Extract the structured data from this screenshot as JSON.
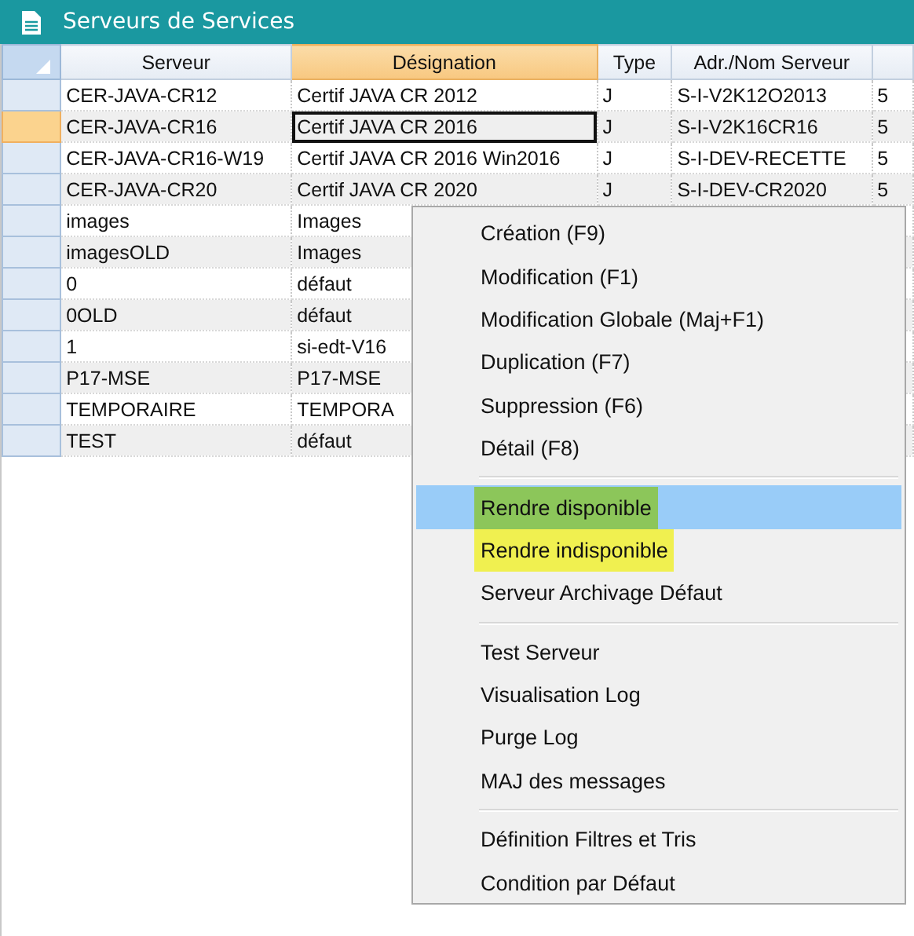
{
  "window": {
    "title": "Serveurs de Services"
  },
  "table": {
    "columns": [
      {
        "label": "Serveur",
        "selected": false
      },
      {
        "label": "Désignation",
        "selected": true
      },
      {
        "label": "Type",
        "selected": false
      },
      {
        "label": "Adr./Nom Serveur",
        "selected": false
      },
      {
        "selected": false
      }
    ],
    "rows": [
      {
        "selected": false,
        "cells": [
          "CER-JAVA-CR12",
          "Certif JAVA CR 2012",
          "J",
          "S-I-V2K12O2013",
          "5"
        ]
      },
      {
        "selected": true,
        "cells": [
          "CER-JAVA-CR16",
          "Certif JAVA CR 2016",
          "J",
          "S-I-V2K16CR16",
          "5"
        ]
      },
      {
        "selected": false,
        "cells": [
          "CER-JAVA-CR16-W19",
          "Certif JAVA CR 2016 Win2016",
          "J",
          "S-I-DEV-RECETTE",
          "5"
        ]
      },
      {
        "selected": false,
        "cells": [
          "CER-JAVA-CR20",
          "Certif JAVA CR 2020",
          "J",
          "S-I-DEV-CR2020",
          "5"
        ]
      },
      {
        "selected": false,
        "cells": [
          "images",
          "Images"
        ]
      },
      {
        "selected": false,
        "cells": [
          "imagesOLD",
          "Images"
        ]
      },
      {
        "selected": false,
        "cells": [
          "0",
          "défaut"
        ]
      },
      {
        "selected": false,
        "cells": [
          "0OLD",
          "défaut"
        ]
      },
      {
        "selected": false,
        "cells": [
          "1",
          "si-edt-V16"
        ]
      },
      {
        "selected": false,
        "cells": [
          "P17-MSE",
          "P17-MSE"
        ]
      },
      {
        "selected": false,
        "cells": [
          "TEMPORAIRE",
          "TEMPORA"
        ]
      },
      {
        "selected": false,
        "cells": [
          "TEST",
          "défaut"
        ]
      }
    ]
  },
  "context_menu": {
    "groups": [
      [
        {
          "label": "Création (F9)",
          "selected": false
        },
        {
          "label": "Modification (F1)",
          "selected": false
        },
        {
          "label": "Modification Globale (Maj+F1)",
          "selected": false
        },
        {
          "label": "Duplication (F7)",
          "selected": false
        },
        {
          "label": "Suppression (F6)",
          "selected": false
        },
        {
          "label": "Détail (F8)",
          "selected": false
        }
      ],
      [
        {
          "label": "Rendre disponible",
          "selected": true,
          "color": "#8cc65a"
        },
        {
          "label": "Rendre indisponible",
          "selected": false,
          "color": "#f0f050"
        },
        {
          "label": "Serveur Archivage Défaut",
          "selected": false
        }
      ],
      [
        {
          "label": "Test Serveur",
          "selected": false
        },
        {
          "label": "Visualisation Log",
          "selected": false
        },
        {
          "label": "Purge Log",
          "selected": false
        },
        {
          "label": "MAJ des messages",
          "selected": false
        }
      ],
      [
        {
          "label": "Définition Filtres et Tris",
          "selected": false
        },
        {
          "label": "Condition par Défaut",
          "selected": false
        }
      ]
    ]
  }
}
